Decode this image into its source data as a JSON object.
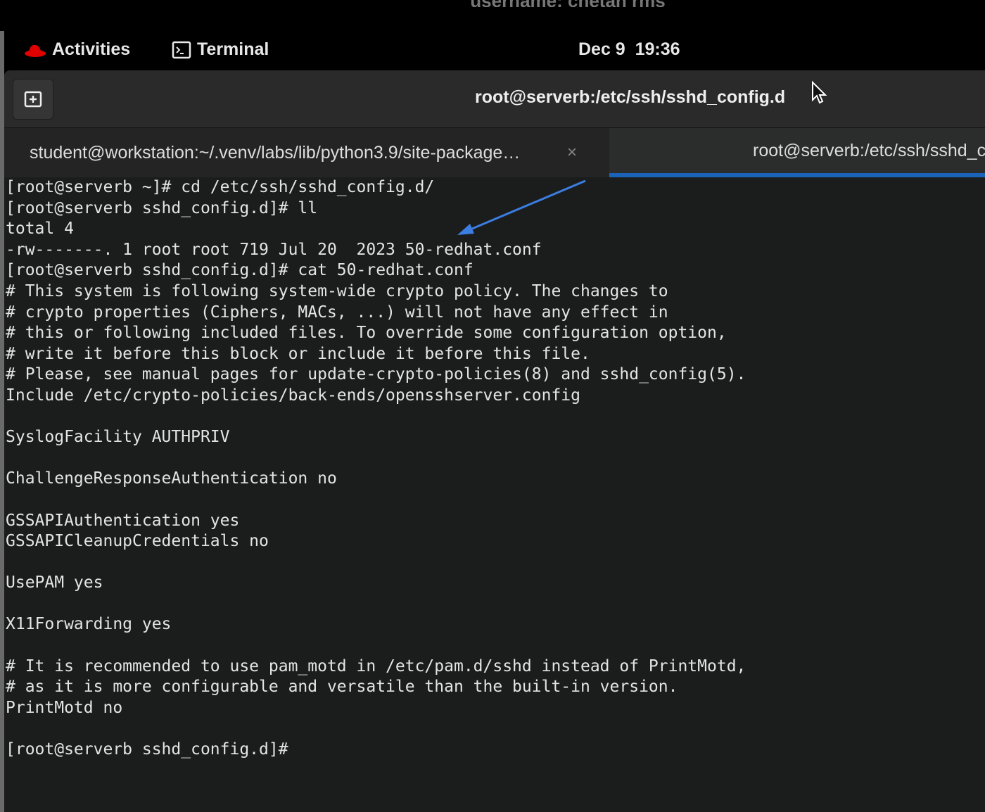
{
  "caption": "username: chetan rms",
  "topbar": {
    "activities": "Activities",
    "app": "Terminal",
    "clock": "Dec 9  19:36"
  },
  "window": {
    "title": "root@serverb:/etc/ssh/sshd_config.d"
  },
  "tabs": [
    {
      "label": "student@workstation:~/.venv/labs/lib/python3.9/site-package…",
      "close": "×"
    },
    {
      "label": "root@serverb:/etc/ssh/sshd_config.d"
    }
  ],
  "terminal": {
    "lines": [
      "[root@serverb ~]# cd /etc/ssh/sshd_config.d/",
      "[root@serverb sshd_config.d]# ll",
      "total 4",
      "-rw-------. 1 root root 719 Jul 20  2023 50-redhat.conf",
      "[root@serverb sshd_config.d]# cat 50-redhat.conf",
      "# This system is following system-wide crypto policy. The changes to",
      "# crypto properties (Ciphers, MACs, ...) will not have any effect in",
      "# this or following included files. To override some configuration option,",
      "# write it before this block or include it before this file.",
      "# Please, see manual pages for update-crypto-policies(8) and sshd_config(5).",
      "Include /etc/crypto-policies/back-ends/opensshserver.config",
      "",
      "SyslogFacility AUTHPRIV",
      "",
      "ChallengeResponseAuthentication no",
      "",
      "GSSAPIAuthentication yes",
      "GSSAPICleanupCredentials no",
      "",
      "UsePAM yes",
      "",
      "X11Forwarding yes",
      "",
      "# It is recommended to use pam_motd in /etc/pam.d/sshd instead of PrintMotd,",
      "# as it is more configurable and versatile than the built-in version.",
      "PrintMotd no",
      "",
      "[root@serverb sshd_config.d]#"
    ]
  },
  "colors": {
    "accent": "#1a63b8",
    "arrow": "#3b7de0",
    "redhat": "#e00000"
  }
}
